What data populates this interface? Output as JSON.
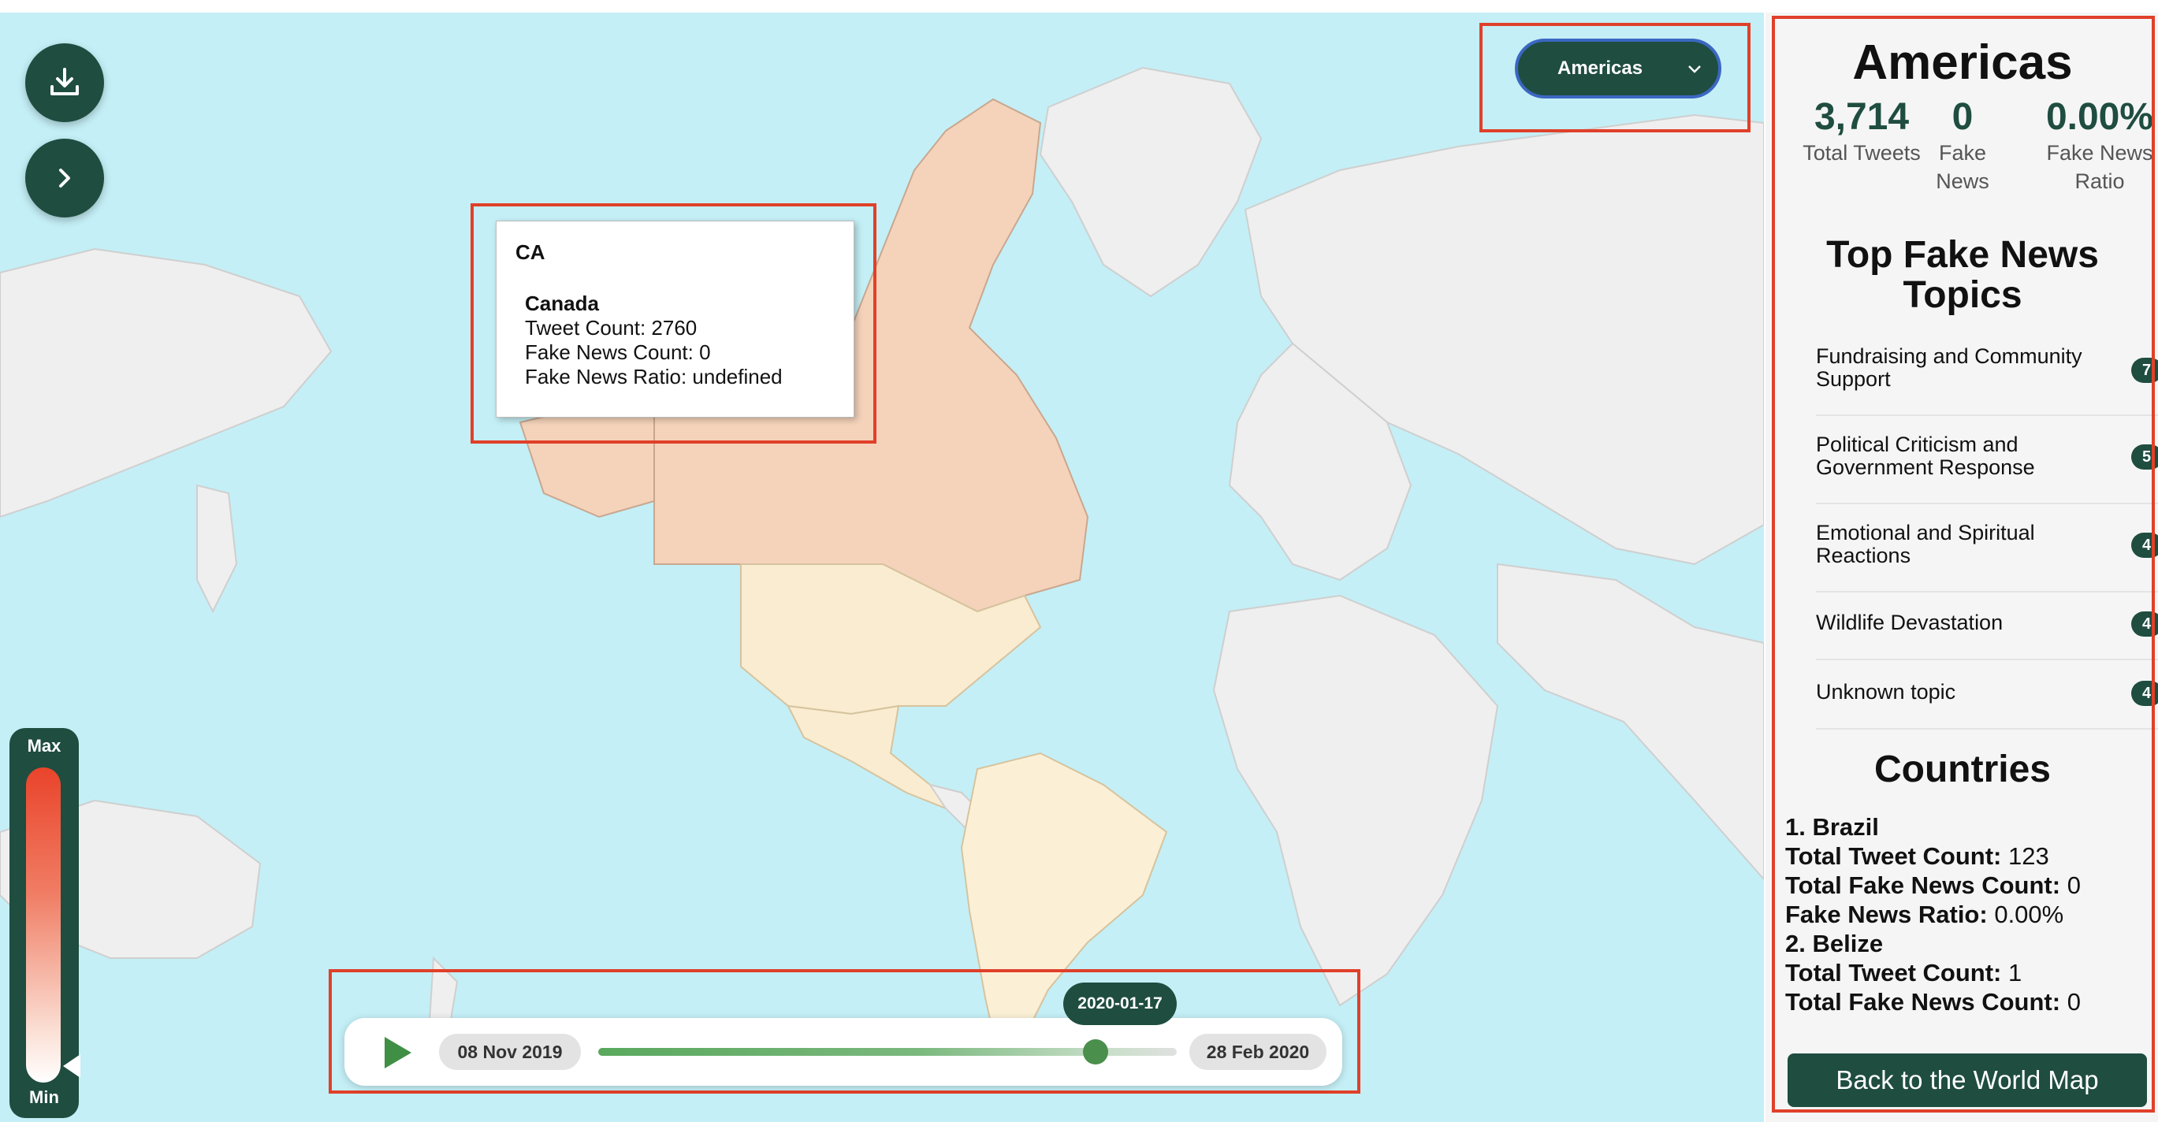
{
  "region_selector": {
    "selected": "Americas"
  },
  "tooltip": {
    "code": "CA",
    "country": "Canada",
    "tweet_count_line": "Tweet Count: 2760",
    "fake_news_count_line": "Fake News Count: 0",
    "fake_news_ratio_line": "Fake News Ratio: undefined"
  },
  "legend": {
    "max_label": "Max",
    "min_label": "Min"
  },
  "timeline": {
    "start_date": "08 Nov 2019",
    "end_date": "28 Feb 2020",
    "current_date": "2020-01-17",
    "progress_fraction": 0.86
  },
  "panel": {
    "region_title": "Americas",
    "stats": [
      {
        "value": "3,714",
        "label": "Total Tweets"
      },
      {
        "value": "0",
        "label": "Fake News"
      },
      {
        "value": "0.00%",
        "label": "Fake News Ratio"
      }
    ],
    "topics_heading": "Top Fake News Topics",
    "topics": [
      {
        "label": "Fundraising and Community Support",
        "count": "7"
      },
      {
        "label": "Political Criticism and Government Response",
        "count": "5"
      },
      {
        "label": "Emotional and Spiritual Reactions",
        "count": "4"
      },
      {
        "label": "Wildlife Devastation",
        "count": "4"
      },
      {
        "label": "Unknown topic",
        "count": "4"
      }
    ],
    "countries_heading": "Countries",
    "countries": [
      {
        "name": "1. Brazil",
        "tweet_label": "Total Tweet Count:",
        "tweet_value": "123",
        "fake_label": "Total Fake News Count:",
        "fake_value": "0",
        "ratio_label": "Fake News Ratio:",
        "ratio_value": "0.00%"
      },
      {
        "name": "2. Belize",
        "tweet_label": "Total Tweet Count:",
        "tweet_value": "1",
        "fake_label": "Total Fake News Count:",
        "fake_value": "0"
      }
    ],
    "back_button": "Back to the World Map"
  },
  "colors": {
    "primary": "#1f4d40",
    "ocean": "#c4eff6",
    "highlight": "#e0402a"
  },
  "icons": {
    "download": "download-icon",
    "expand": "chevron-right-icon",
    "play": "play-icon"
  }
}
